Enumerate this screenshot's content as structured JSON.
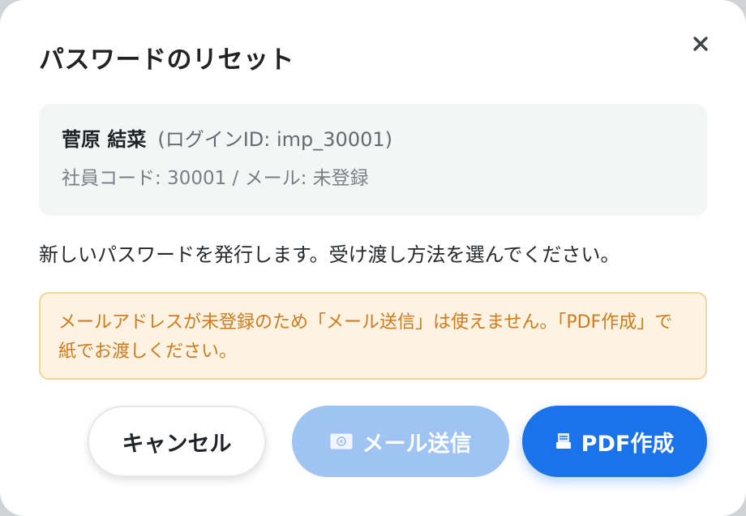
{
  "dialog": {
    "title": "パスワードのリセット",
    "close_icon": "close-icon"
  },
  "user": {
    "name": "菅原 結菜",
    "login_id": "(ログインID: imp_30001)",
    "details": "社員コード: 30001 / メール: 未登録"
  },
  "instruction": "新しいパスワードを発行します。受け渡し方法を選んでください。",
  "warning": {
    "text": "メールアドレスが未登録のため「メール送信」は使えません。「PDF作成」で紙でお渡しください。",
    "color": "#d07a1b",
    "background": "#fef3e2"
  },
  "buttons": {
    "cancel_label": "キャンセル",
    "mail_label": "メール送信",
    "mail_icon": "envelope-icon",
    "mail_disabled": true,
    "pdf_label": "PDF作成",
    "pdf_icon": "document-icon",
    "accent_color": "#1a73e8"
  }
}
